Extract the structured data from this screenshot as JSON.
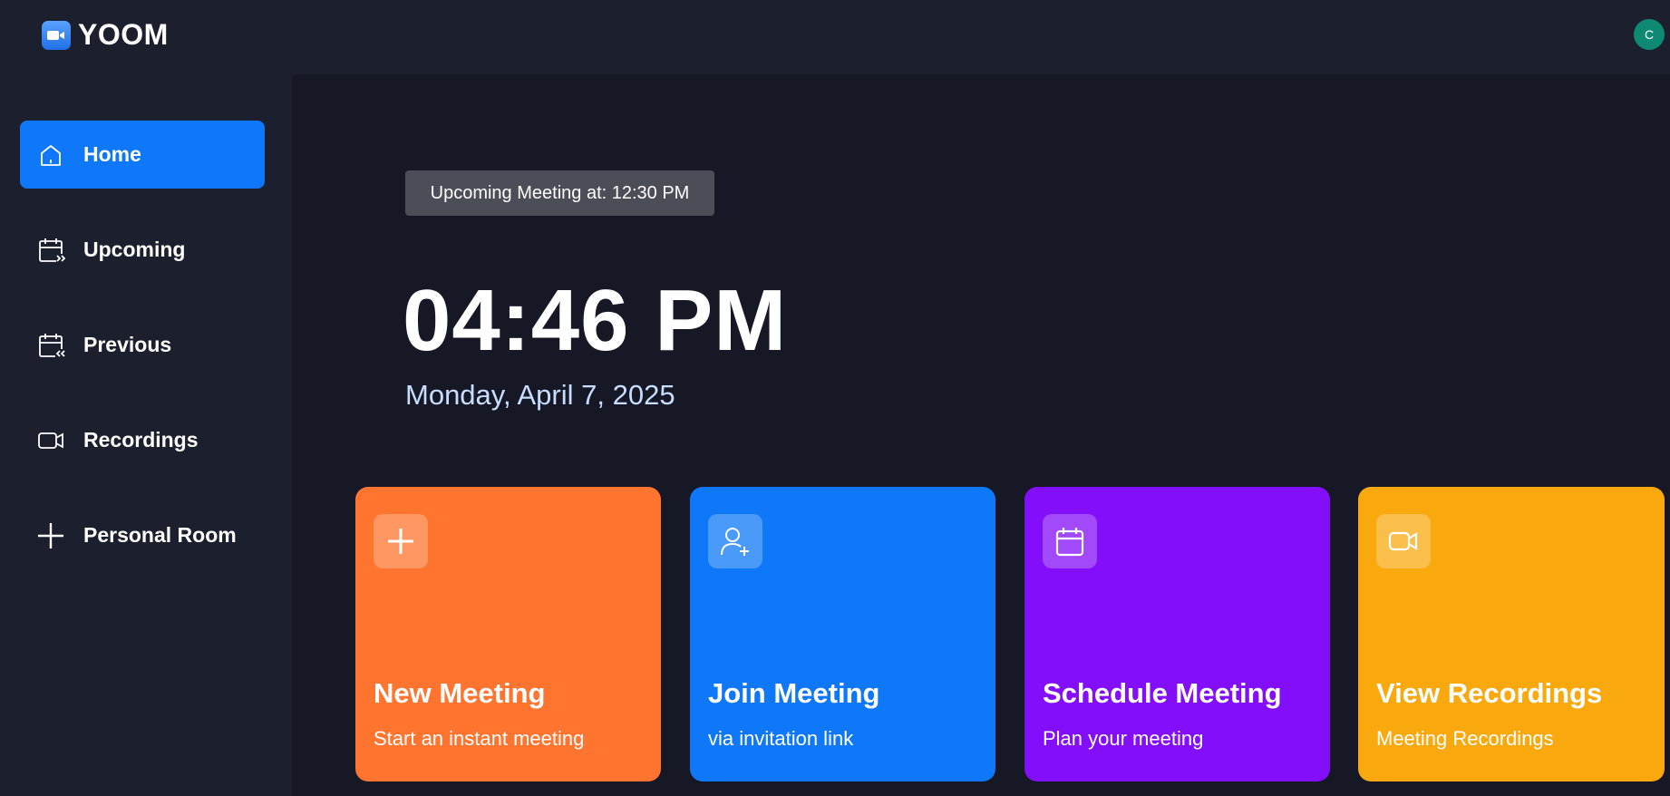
{
  "app": {
    "name": "YOOM"
  },
  "user": {
    "avatar_initial": "C"
  },
  "sidebar": {
    "items": [
      {
        "label": "Home",
        "icon": "home-icon",
        "active": true
      },
      {
        "label": "Upcoming",
        "icon": "calendar-forward-icon",
        "active": false
      },
      {
        "label": "Previous",
        "icon": "calendar-back-icon",
        "active": false
      },
      {
        "label": "Recordings",
        "icon": "video-icon",
        "active": false
      },
      {
        "label": "Personal Room",
        "icon": "plus-icon",
        "active": false
      }
    ]
  },
  "hero": {
    "upcoming": "Upcoming Meeting at: 12:30 PM",
    "time": "04:46 PM",
    "date": "Monday, April 7, 2025"
  },
  "cards": [
    {
      "title": "New Meeting",
      "subtitle": "Start an instant meeting",
      "icon": "plus-icon",
      "color": "#ff742e"
    },
    {
      "title": "Join Meeting",
      "subtitle": "via invitation link",
      "icon": "user-add-icon",
      "color": "#0e78f9"
    },
    {
      "title": "Schedule Meeting",
      "subtitle": "Plan your meeting",
      "icon": "calendar-icon",
      "color": "#830ef9"
    },
    {
      "title": "View Recordings",
      "subtitle": "Meeting Recordings",
      "icon": "video-icon",
      "color": "#f9a90e"
    }
  ],
  "colors": {
    "background": "#161925",
    "panel": "#1c1f2e",
    "accent": "#0e78f9",
    "badge": "#4b4d57",
    "avatar": "#0e8a74",
    "date_text": "#c9ddff"
  }
}
